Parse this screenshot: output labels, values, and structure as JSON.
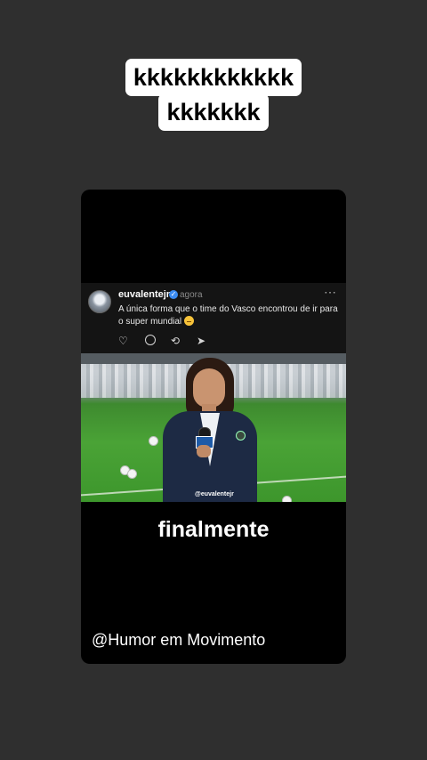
{
  "caption": {
    "line1": "kkkkkkkkkkkk",
    "line2": "kkkkkkk"
  },
  "post": {
    "username": "euvalentejr",
    "verified_mark": "✓",
    "time": "agora",
    "more_icon": "⋯",
    "text": "A única forma que o time do Vasco encontrou de ir para o super mundial",
    "emoji": "smirk-emoji",
    "actions": {
      "like": "♡",
      "repost": "⟲",
      "share": "➤"
    }
  },
  "video": {
    "watermark": "@euvalentejr",
    "overlay_text": "finalmente",
    "credit": "@Humor em Movimento"
  },
  "colors": {
    "background": "#2f2f2f",
    "verified": "#3b8bf0",
    "card": "#000000",
    "post_bg": "#141414"
  }
}
